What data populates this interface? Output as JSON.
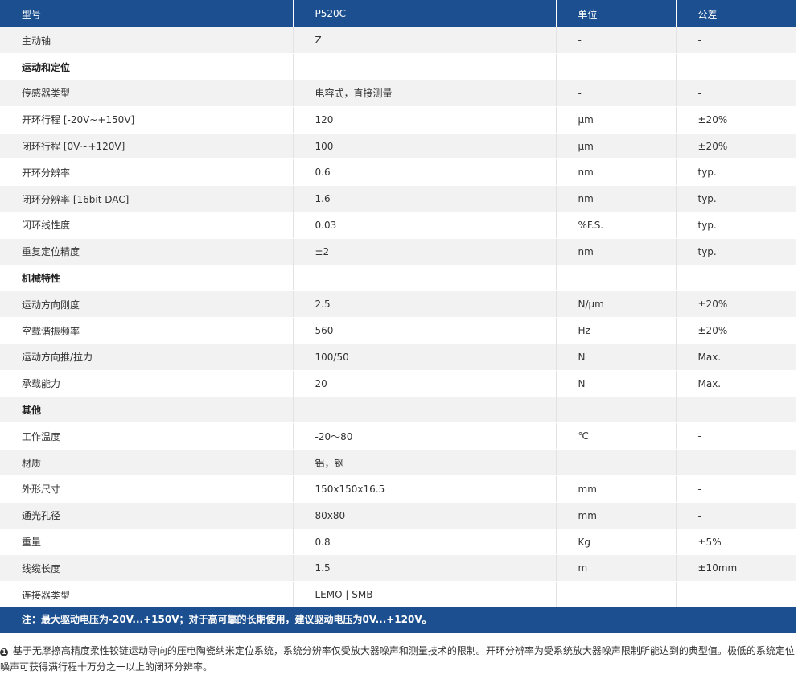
{
  "table": {
    "headers": [
      "型号",
      "P520C",
      "单位",
      "公差"
    ],
    "rows": [
      {
        "type": "data",
        "cells": [
          "主动轴",
          "Z",
          "-",
          "-"
        ]
      },
      {
        "type": "section",
        "cells": [
          "运动和定位",
          "",
          "",
          ""
        ]
      },
      {
        "type": "data",
        "cells": [
          "传感器类型",
          "电容式，直接测量",
          "-",
          "-"
        ]
      },
      {
        "type": "data",
        "cells": [
          "开环行程 [-20V~+150V]",
          "120",
          "μm",
          "±20%"
        ]
      },
      {
        "type": "data",
        "cells": [
          "闭环行程 [0V~+120V]",
          "100",
          "μm",
          "±20%"
        ]
      },
      {
        "type": "data",
        "cells": [
          "开环分辨率",
          "0.6",
          "nm",
          "typ."
        ]
      },
      {
        "type": "data",
        "cells": [
          "闭环分辨率 [16bit DAC]",
          "1.6",
          "nm",
          "typ."
        ]
      },
      {
        "type": "data",
        "cells": [
          "闭环线性度",
          "0.03",
          "%F.S.",
          "typ."
        ]
      },
      {
        "type": "data",
        "cells": [
          "重复定位精度",
          "±2",
          "nm",
          "typ."
        ]
      },
      {
        "type": "section",
        "cells": [
          "机械特性",
          "",
          "",
          ""
        ]
      },
      {
        "type": "data",
        "cells": [
          "运动方向刚度",
          "2.5",
          "N/μm",
          "±20%"
        ]
      },
      {
        "type": "data",
        "cells": [
          "空载谐振频率",
          "560",
          "Hz",
          "±20%"
        ]
      },
      {
        "type": "data",
        "cells": [
          "运动方向推/拉力",
          "100/50",
          "N",
          "Max."
        ]
      },
      {
        "type": "data",
        "cells": [
          "承载能力",
          "20",
          "N",
          "Max."
        ]
      },
      {
        "type": "section",
        "cells": [
          "其他",
          "",
          "",
          ""
        ]
      },
      {
        "type": "data",
        "cells": [
          "工作温度",
          "-20～80",
          "℃",
          "-"
        ]
      },
      {
        "type": "data",
        "cells": [
          "材质",
          "铝，钢",
          "-",
          "-"
        ]
      },
      {
        "type": "data",
        "cells": [
          "外形尺寸",
          "150x150x16.5",
          "mm",
          "-"
        ]
      },
      {
        "type": "data",
        "cells": [
          "通光孔径",
          "80x80",
          "mm",
          "-"
        ]
      },
      {
        "type": "data",
        "cells": [
          "重量",
          "0.8",
          "Kg",
          "±5%"
        ]
      },
      {
        "type": "data",
        "cells": [
          "线缆长度",
          "1.5",
          "m",
          "±10mm"
        ]
      },
      {
        "type": "data",
        "cells": [
          "连接器类型",
          "LEMO | SMB",
          "-",
          "-"
        ]
      }
    ]
  },
  "note": "注：最大驱动电压为-20V...+150V；对于高可靠的长期使用，建议驱动电压为0V...+120V。",
  "footnote": {
    "marker": "1",
    "text": "基于无摩擦高精度柔性铰链运动导向的压电陶瓷纳米定位系统，系统分辨率仅受放大器噪声和测量技术的限制。开环分辨率为受系统放大器噪声限制所能达到的典型值。极低的系统定位噪声可获得满行程十万分之一以上的闭环分辨率。"
  },
  "colors": {
    "header_bg": "#1c4f8f",
    "row_alt_bg": "#f2f2f2",
    "row_bg": "#ffffff"
  }
}
